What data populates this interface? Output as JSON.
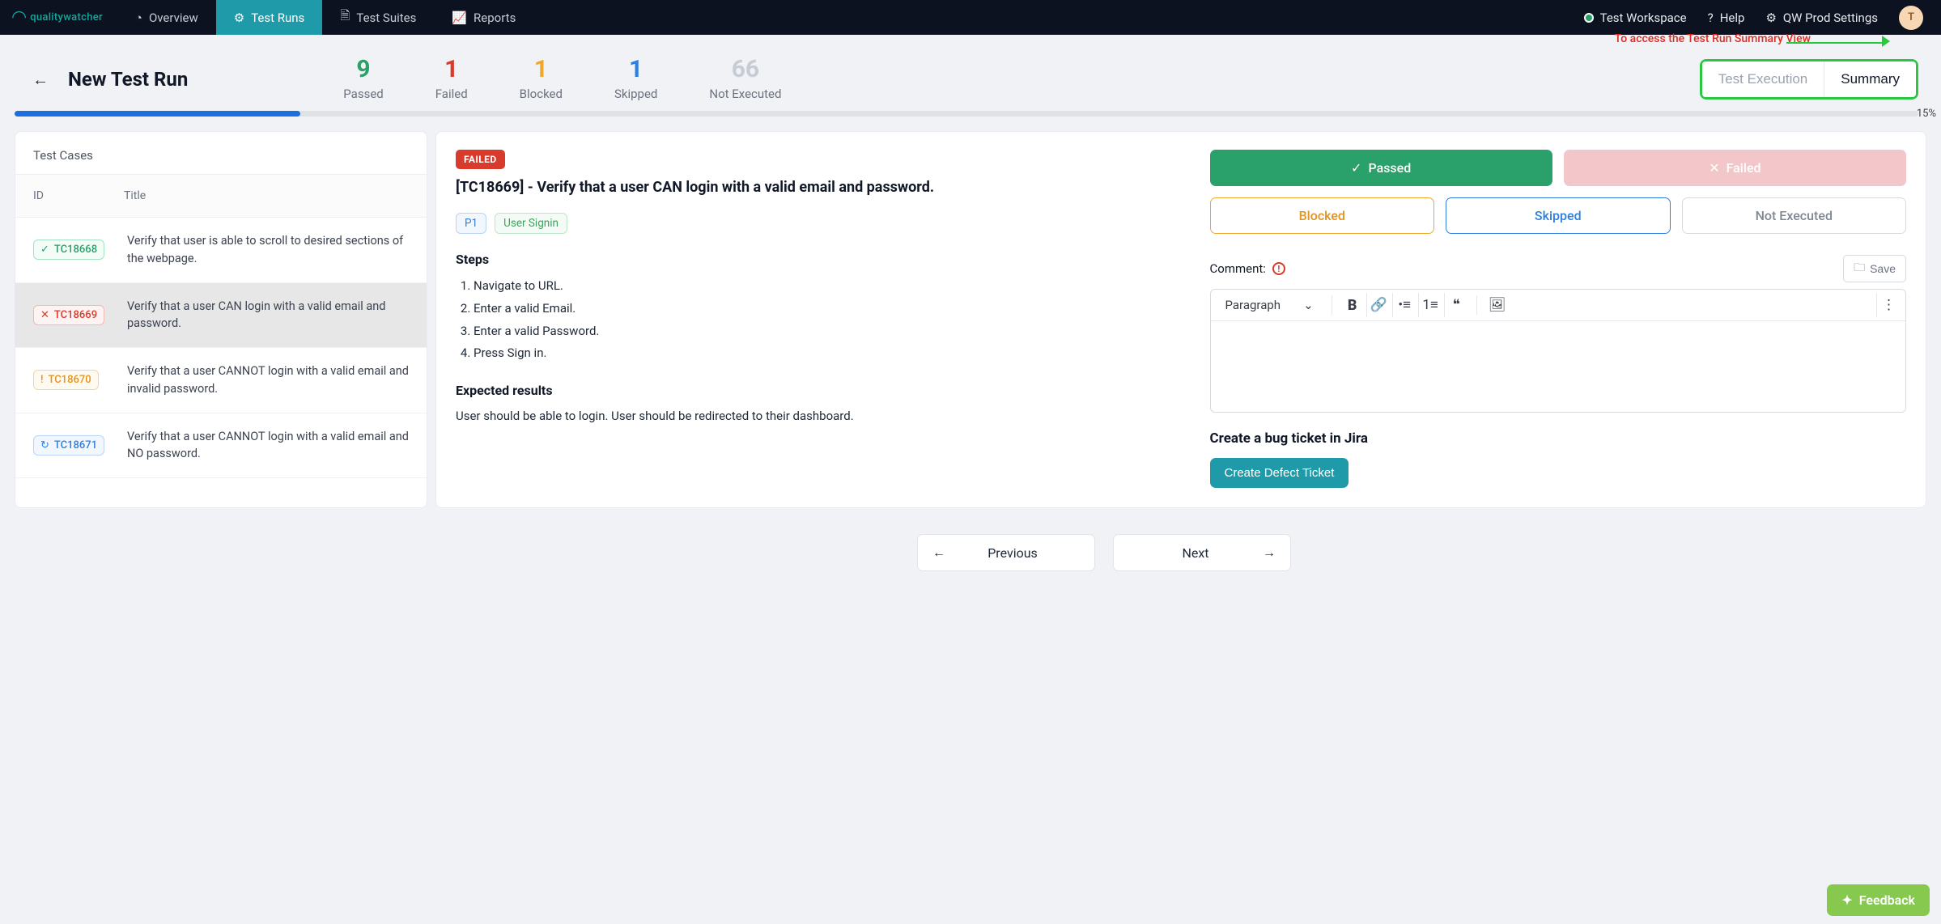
{
  "brand": {
    "name": "qualitywatcher"
  },
  "nav": {
    "overview": "Overview",
    "testruns": "Test Runs",
    "testsuites": "Test Suites",
    "reports": "Reports",
    "workspace": "Test Workspace",
    "help": "Help",
    "settings": "QW Prod Settings",
    "avatar_initial": "T"
  },
  "page": {
    "title": "New Test Run",
    "annotation": "To access the Test Run Summary View",
    "view_exec": "Test Execution",
    "view_summary": "Summary",
    "progress_pct": "15%"
  },
  "stats": {
    "passed": {
      "n": "9",
      "label": "Passed"
    },
    "failed": {
      "n": "1",
      "label": "Failed"
    },
    "blocked": {
      "n": "1",
      "label": "Blocked"
    },
    "skipped": {
      "n": "1",
      "label": "Skipped"
    },
    "notexec": {
      "n": "66",
      "label": "Not Executed"
    }
  },
  "list": {
    "header": "Test Cases",
    "col_id": "ID",
    "col_title": "Title",
    "rows": [
      {
        "id": "TC18668",
        "title": "Verify that user is able to scroll to desired sections of the webpage.",
        "status": "passed"
      },
      {
        "id": "TC18669",
        "title": "Verify that a user CAN login with a valid email and password.",
        "status": "failed"
      },
      {
        "id": "TC18670",
        "title": "Verify that a user CANNOT login with a valid email and invalid password.",
        "status": "blocked"
      },
      {
        "id": "TC18671",
        "title": "Verify that a user CANNOT login with a valid email and NO password.",
        "status": "skipped"
      }
    ]
  },
  "detail": {
    "status_chip": "FAILED",
    "title": "[TC18669] - Verify that a user CAN login with a valid email and password.",
    "tag_priority": "P1",
    "tag_module": "User Signin",
    "steps_h": "Steps",
    "steps": [
      "Navigate to URL.",
      "Enter a valid Email.",
      "Enter a valid Password.",
      "Press Sign in."
    ],
    "expected_h": "Expected results",
    "expected": "User should be able to login. User should be redirected to their dashboard."
  },
  "actions": {
    "passed": "Passed",
    "failed": "Failed",
    "blocked": "Blocked",
    "skipped": "Skipped",
    "notexec": "Not Executed",
    "comment_lbl": "Comment:",
    "save": "Save",
    "paragraph": "Paragraph",
    "jira_h": "Create a bug ticket in Jira",
    "jira_btn": "Create Defect Ticket"
  },
  "pager": {
    "prev": "Previous",
    "next": "Next"
  },
  "feedback": "Feedback"
}
